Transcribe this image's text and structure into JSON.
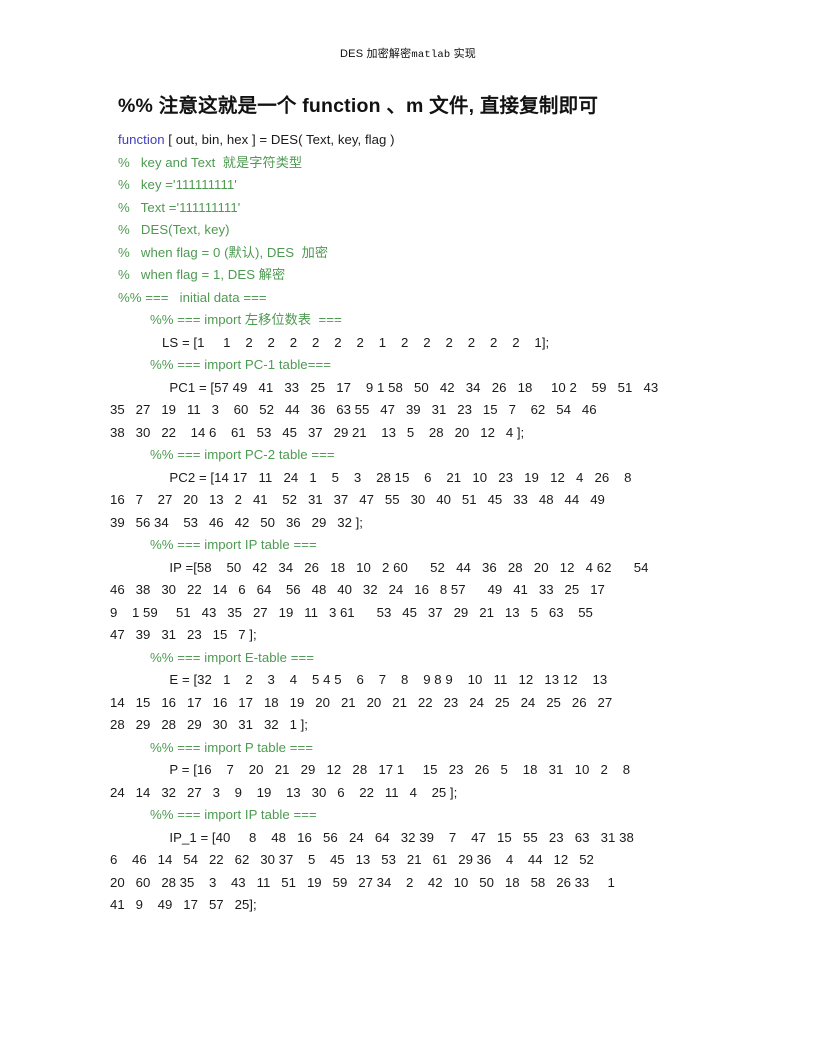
{
  "document": {
    "header_text": "DES 加密解密matlab 实现",
    "header_parts": {
      "pre": "DES ",
      "cjk1": "加密解密",
      "mono": "matlab",
      "cjk2": " 实现"
    },
    "title": "%% 注意这就是一个 function 、m 文件, 直接复制即可",
    "colors": {
      "text": "#1a1a1a",
      "keyword": "#3f3fbf",
      "comment": "#4e9a52",
      "page_background": "#ffffff"
    }
  },
  "code": {
    "signature": {
      "keyword": "function",
      "rest": " [ out, bin, hex ] = DES( Text, key, flag )"
    },
    "comments": [
      "%   key and Text  就是字符类型",
      "%   key ='111111111'",
      "%   Text ='111111111'",
      "%   DES(Text, key)",
      "%   when flag = 0 (默认), DES  加密",
      "%   when flag = 1, DES 解密"
    ],
    "section_initial": "%% ===   initial data ===",
    "blocks": [
      {
        "comment": "%% === import 左移位数表  ===",
        "indent": "ind3",
        "lines": [
          "LS = [1     1    2    2    2    2    2    2    1    2    2    2    2    2    2    1];"
        ],
        "wrapped": []
      },
      {
        "comment": "%% === import PC-1 table===",
        "indent": "ind3",
        "lines": [
          "  PC1 = [57 49   41   33   25   17    9 1 58   50   42   34   26   18     10 2    59   51   43"
        ],
        "wrapped": [
          "35   27   19   11   3    60   52   44   36   63 55   47   39   31   23   15   7    62   54   46",
          "38   30   22    14 6    61   53   45   37   29 21    13   5    28   20   12   4 ];"
        ]
      },
      {
        "comment": "%% === import PC-2 table ===",
        "indent": "ind3",
        "lines": [
          "  PC2 = [14 17   11   24   1    5    3    28 15    6    21   10   23   19   12   4   26    8"
        ],
        "wrapped": [
          "16   7    27   20   13   2   41    52   31   37   47   55   30   40   51   45   33   48   44   49",
          "39   56 34    53   46   42   50   36   29   32 ];"
        ]
      },
      {
        "comment": "%% === import IP table ===",
        "indent": "ind3",
        "lines": [
          "  IP =[58    50   42   34   26   18   10   2 60      52   44   36   28   20   12   4 62      54"
        ],
        "wrapped": [
          "46   38   30   22   14   6   64    56   48   40   32   24   16   8 57      49   41   33   25   17",
          "9    1 59     51   43   35   27   19   11   3 61      53   45   37   29   21   13   5   63    55",
          "47   39   31   23   15   7 ];"
        ]
      },
      {
        "comment": "%% === import E-table ===",
        "indent": "ind3",
        "lines": [
          "  E = [32   1    2    3    4    5 4 5    6    7    8    9 8 9    10   11   12   13 12    13"
        ],
        "wrapped": [
          "14   15   16   17   16   17   18   19   20   21   20   21   22   23   24   25   24   25   26   27",
          "28   29   28   29   30   31   32   1 ];"
        ]
      },
      {
        "comment": "%% === import P table ===",
        "indent": "ind3",
        "lines": [
          "  P = [16    7    20   21   29   12   28   17 1     15   23   26   5    18   31   10   2    8"
        ],
        "wrapped": [
          "24   14   32   27   3    9    19    13   30   6    22   11   4    25 ];"
        ]
      },
      {
        "comment": "%% === import IP table ===",
        "indent": "ind3",
        "lines": [
          "  IP_1 = [40     8    48   16   56   24   64   32 39    7    47   15   55   23   63   31 38"
        ],
        "wrapped": [
          "6    46   14   54   22   62   30 37    5    45   13   53   21   61   29 36    4    44   12   52",
          "20   60   28 35    3    43   11   51   19   59   27 34    2    42   10   50   18   58   26 33     1",
          "41   9    49   17   57   25];"
        ]
      }
    ]
  }
}
